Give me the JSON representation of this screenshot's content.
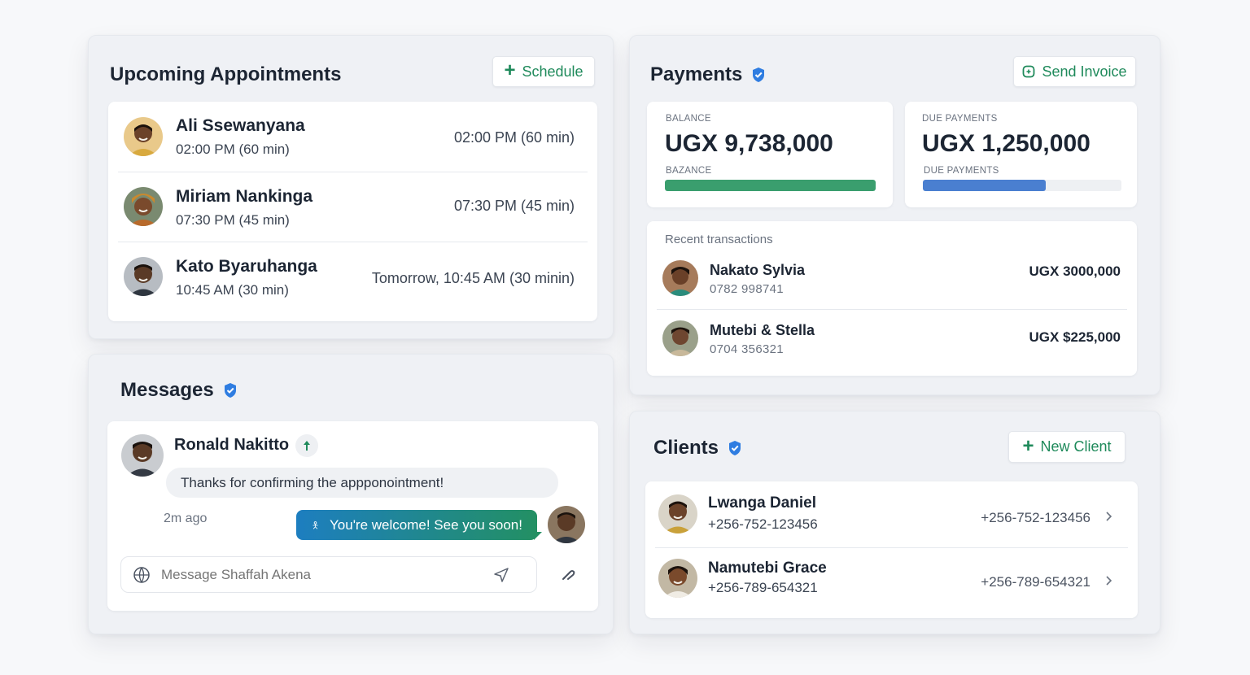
{
  "appointments": {
    "title": "Upcoming Appointments",
    "schedule_label": "Schedule",
    "items": [
      {
        "name": "Ali Ssewanyana",
        "sub": "02:00 PM  (60 min)",
        "right": "02:00 PM  (60 min)"
      },
      {
        "name": "Miriam Nankinga",
        "sub": "07:30 PM  (45 min)",
        "right": "07:30 PM  (45 min)"
      },
      {
        "name": "Kato Byaruhanga",
        "sub": "10:45 AM  (30 min)",
        "right": "Tomorrow, 10:45 AM  (30 minin)"
      }
    ]
  },
  "payments": {
    "title": "Payments",
    "send_invoice_label": "Send Invoice",
    "balance": {
      "label": "BALANCE",
      "amount": "UGX  9,738,000",
      "bar_label": "BAZANCE",
      "fill": 1.0,
      "color": "#3a9e6e"
    },
    "due": {
      "label": "DUE PAYMENTS",
      "amount": "UGX 1,250,000",
      "bar_label": "DUE PAYMENTS",
      "fill": 0.62,
      "color": "#4a7fd0"
    },
    "recent_label": "Recent transactions",
    "transactions": [
      {
        "name": "Nakato Sylvia",
        "phone": "0782 998741",
        "amount": "UGX 3000,000"
      },
      {
        "name": "Mutebi & Stella",
        "phone": "0704 356321",
        "amount": "UGX $225,000"
      }
    ]
  },
  "messages": {
    "title": "Messages",
    "sender": "Ronald Nakitto",
    "incoming": "Thanks for confirming the appponointment!",
    "time": "2m ago",
    "outgoing": "You're welcome! See you soon!",
    "input_placeholder": "Message Shaffah Akena"
  },
  "clients": {
    "title": "Clients",
    "new_client_label": "New Client",
    "items": [
      {
        "name": "Lwanga Daniel",
        "phone": "+256-752-123456",
        "right": "+256-752-123456"
      },
      {
        "name": "Namutebi Grace",
        "phone": "+256-789-654321",
        "right": "+256-789-654321"
      }
    ]
  },
  "colors": {
    "accent_green": "#1f8a5b",
    "verified_blue": "#2f7de1"
  }
}
